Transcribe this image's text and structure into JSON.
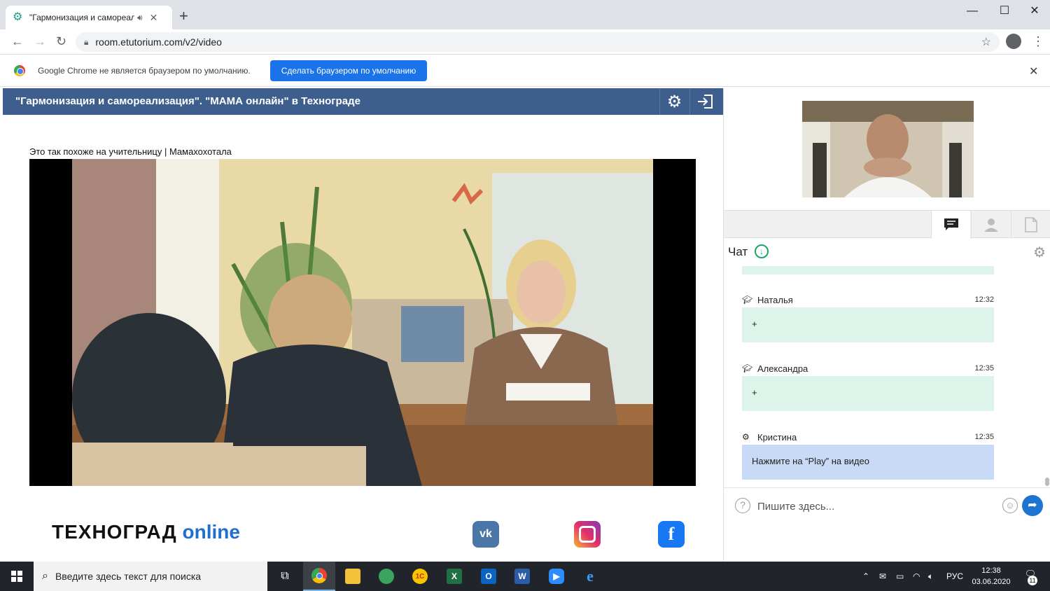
{
  "browser": {
    "tab_title": "\"Гармонизация и самореал",
    "tab_audio_icon": "speaker-icon",
    "url": "room.etutorium.com/v2/video",
    "infobar_text": "Google Chrome не является браузером по умолчанию.",
    "infobar_button": "Сделать браузером по умолчанию"
  },
  "lesson": {
    "title": "\"Гармонизация и самореализация\". \"МАМА онлайн\" в Технограде",
    "video_caption": "Это так похоже на учительницу | Мамахохотала"
  },
  "footer": {
    "brand_main": "ТЕХНОГРАД",
    "brand_online": "online",
    "vk_label": "vk",
    "fb_label": "f"
  },
  "chat": {
    "title": "Чат",
    "messages": [
      {
        "author": "Наталья",
        "time": "12:32",
        "text": "+",
        "role_icon": "graduation-cap-icon"
      },
      {
        "author": "Александра",
        "time": "12:35",
        "text": "+",
        "role_icon": "graduation-cap-icon"
      },
      {
        "author": "Кристина",
        "time": "12:35",
        "text": "Нажмите на “Play” на видео",
        "role_icon": "gear-icon"
      }
    ],
    "input_placeholder": "Пишите здесь..."
  },
  "taskbar": {
    "search_placeholder": "Введите здесь текст для поиска",
    "language": "РУС",
    "time": "12:38",
    "date": "03.06.2020",
    "notification_count": "11"
  },
  "colors": {
    "header_bg": "#3e5e8e",
    "chat_bubble_green": "#dcf4ea",
    "chat_bubble_blue": "#c8daf5",
    "brand_online": "#1e6fd1",
    "infobar_button": "#1a73e8"
  }
}
